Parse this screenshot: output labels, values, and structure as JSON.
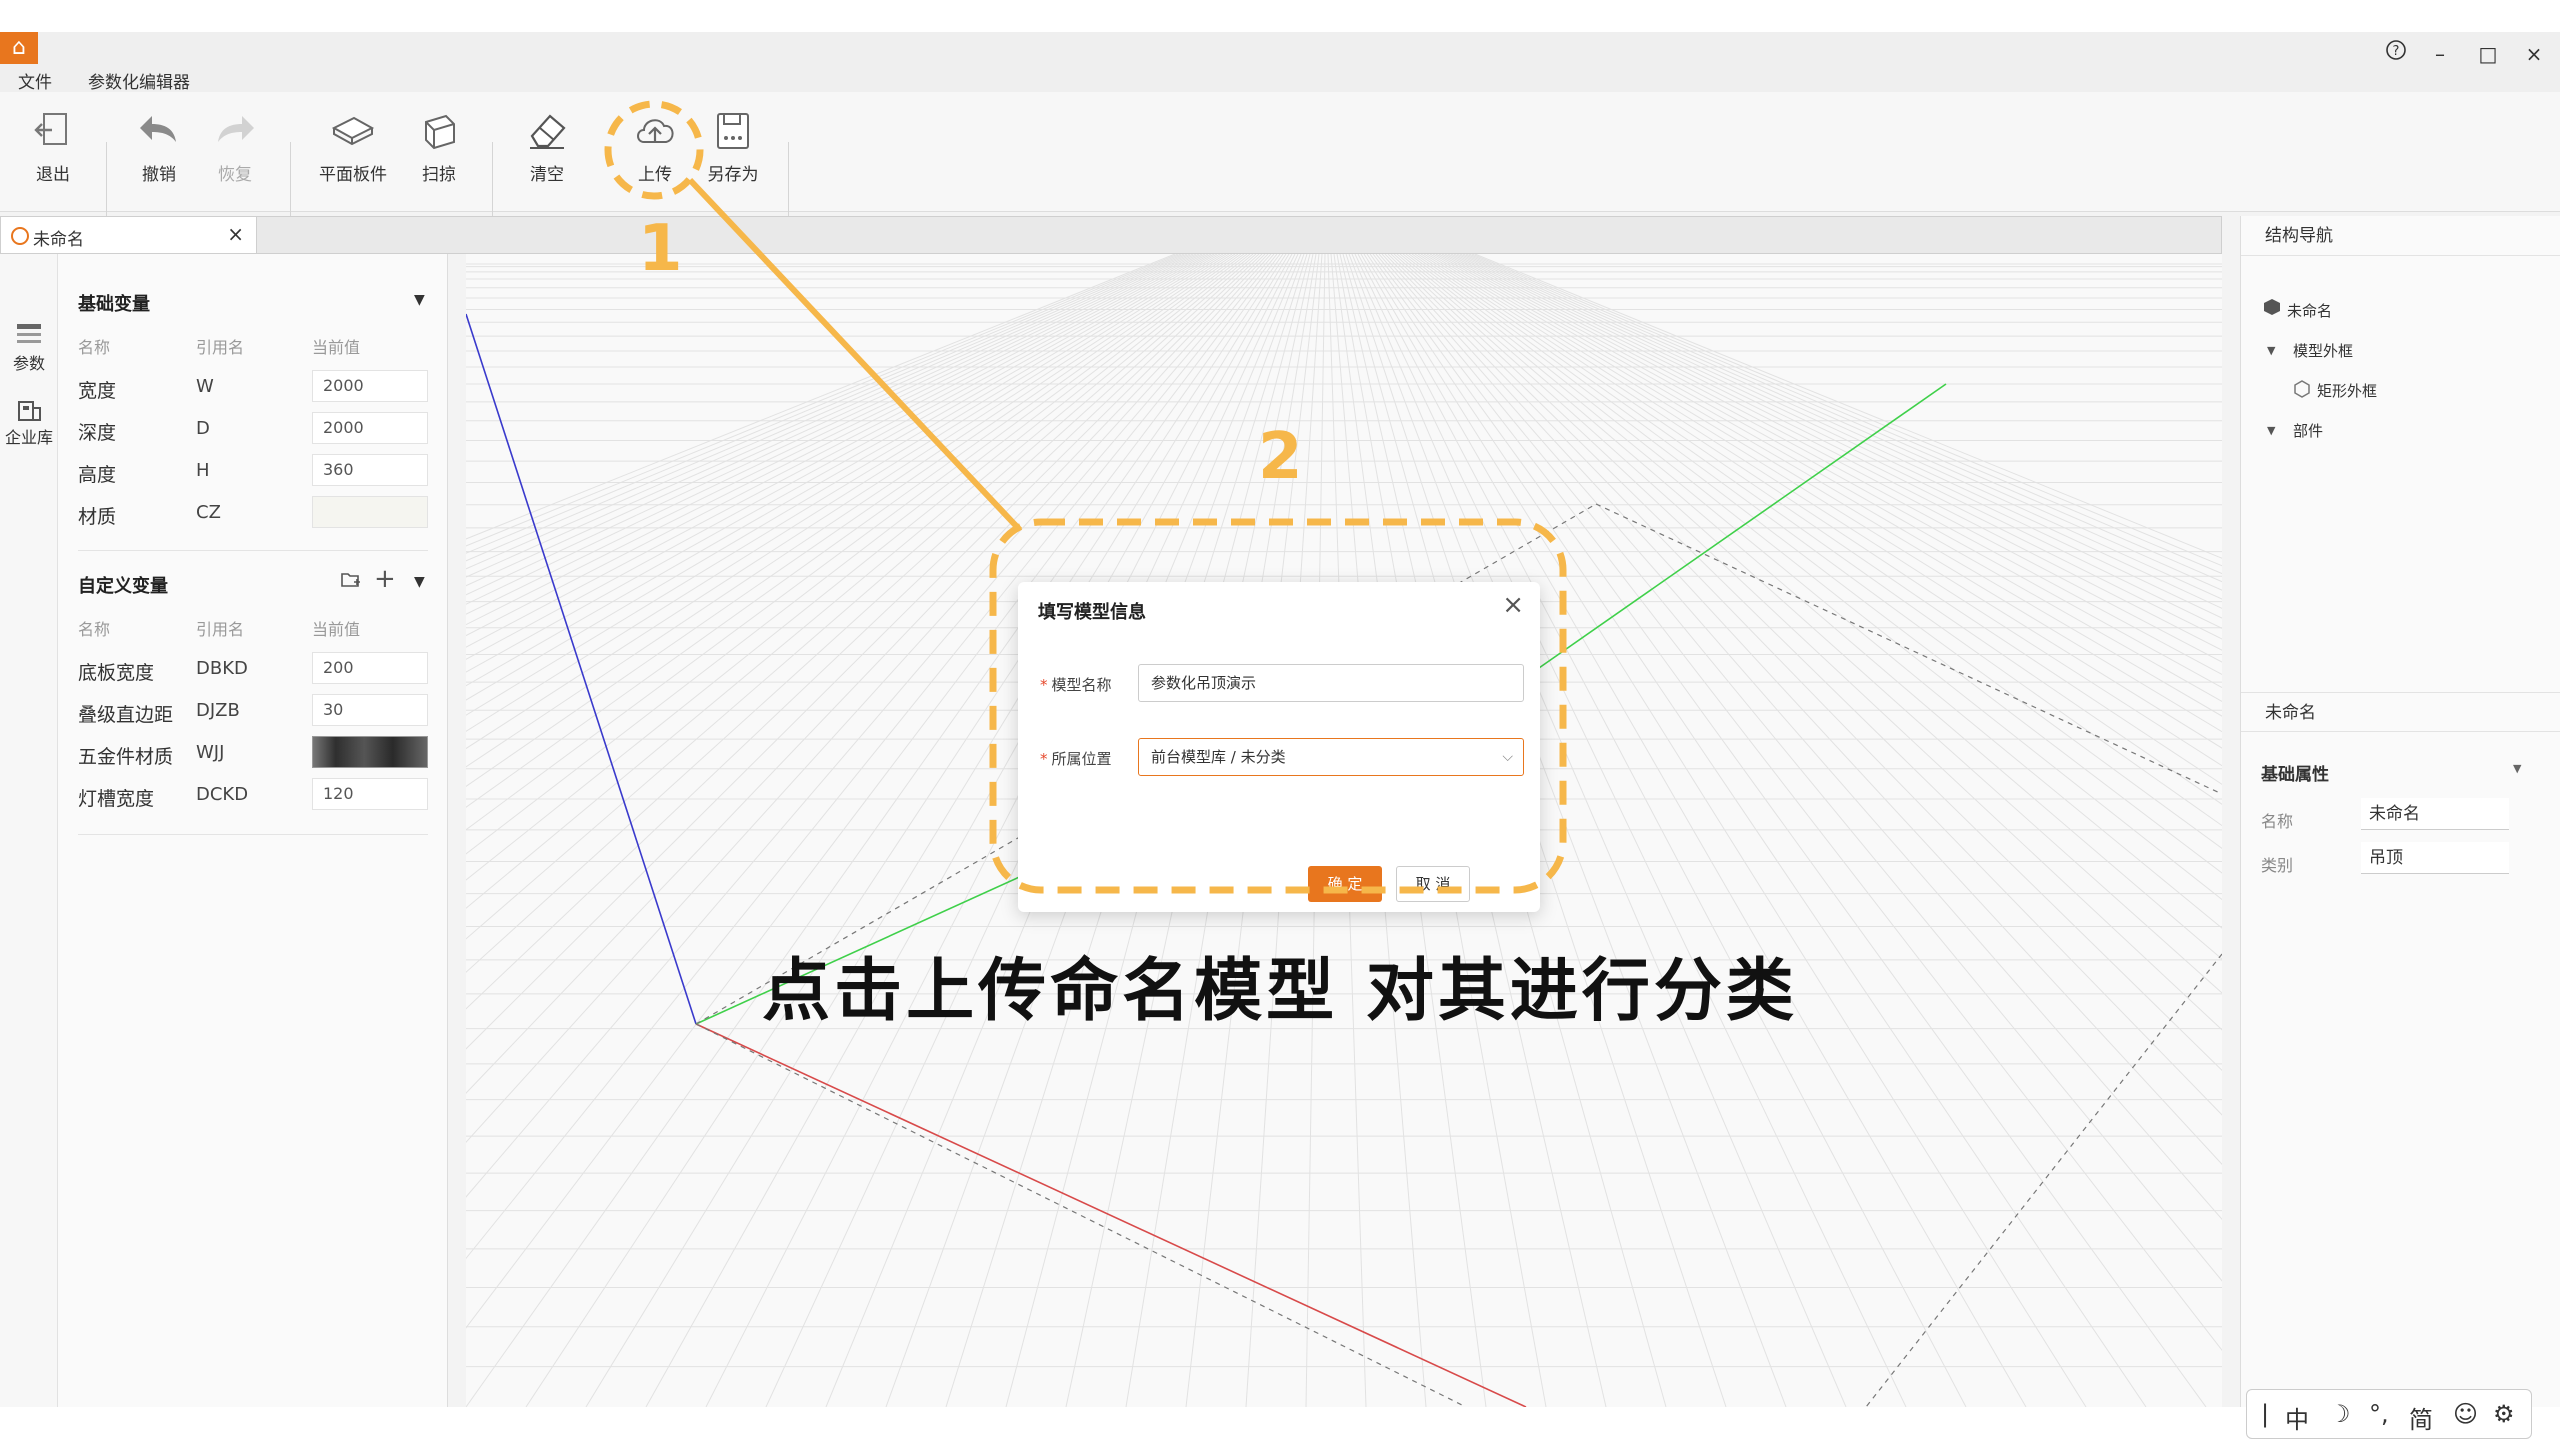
{
  "app": {
    "logo": "⌂"
  },
  "menu": {
    "file": "文件",
    "editor": "参数化编辑器"
  },
  "window": {
    "help": "?",
    "minimize": "–",
    "maximize": "□",
    "close": "×"
  },
  "toolbar": {
    "exit": "退出",
    "undo": "撤销",
    "redo": "恢复",
    "plane_board": "平面板件",
    "sweep": "扫掠",
    "clear": "清空",
    "upload": "上传",
    "save_as": "另存为"
  },
  "doc_tab": {
    "name": "未命名",
    "close": "×"
  },
  "rail": {
    "params": "参数",
    "library": "企业库"
  },
  "basic_vars": {
    "title": "基础变量",
    "headers": [
      "名称",
      "引用名",
      "当前值"
    ],
    "rows": [
      {
        "name": "宽度",
        "ref": "W",
        "value": "2000"
      },
      {
        "name": "深度",
        "ref": "D",
        "value": "2000"
      },
      {
        "name": "高度",
        "ref": "H",
        "value": "360"
      },
      {
        "name": "材质",
        "ref": "CZ",
        "value": ""
      }
    ]
  },
  "custom_vars": {
    "title": "自定义变量",
    "add": "+",
    "headers": [
      "名称",
      "引用名",
      "当前值"
    ],
    "rows": [
      {
        "name": "底板宽度",
        "ref": "DBKD",
        "value": "200"
      },
      {
        "name": "叠级直边距",
        "ref": "DJZB",
        "value": "30"
      },
      {
        "name": "五金件材质",
        "ref": "WJJ",
        "value": ""
      },
      {
        "name": "灯槽宽度",
        "ref": "DCKD",
        "value": "120"
      }
    ]
  },
  "structure_nav": {
    "title": "结构导航",
    "root": "未命名",
    "frame": "模型外框",
    "rect_frame": "矩形外框",
    "parts": "部件"
  },
  "props": {
    "object_name": "未命名",
    "section": "基础属性",
    "name_label": "名称",
    "name_value": "未命名",
    "category_label": "类别",
    "category_value": "吊顶"
  },
  "ime": {
    "cursor": "|",
    "lang": "中",
    "moon": "☽",
    "punct": "°,",
    "simp": "简",
    "emoji": "☺",
    "gear": "⚙"
  },
  "dialog": {
    "title": "填写模型信息",
    "close": "×",
    "name_label": "模型名称",
    "name_value": "参数化吊顶演示",
    "location_label": "所属位置",
    "location_value": "前台模型库 / 未分类",
    "required_mark": "*",
    "ok": "确 定",
    "cancel": "取 消"
  },
  "annotation": {
    "step1": "1",
    "step2": "2",
    "caption": "点击上传命名模型  对其进行分类",
    "color": "#f6b74a"
  },
  "colors": {
    "accent": "#e8761e",
    "axis_x": "#d84a4a",
    "axis_y": "#3fd04a",
    "axis_z": "#3a3acc"
  }
}
